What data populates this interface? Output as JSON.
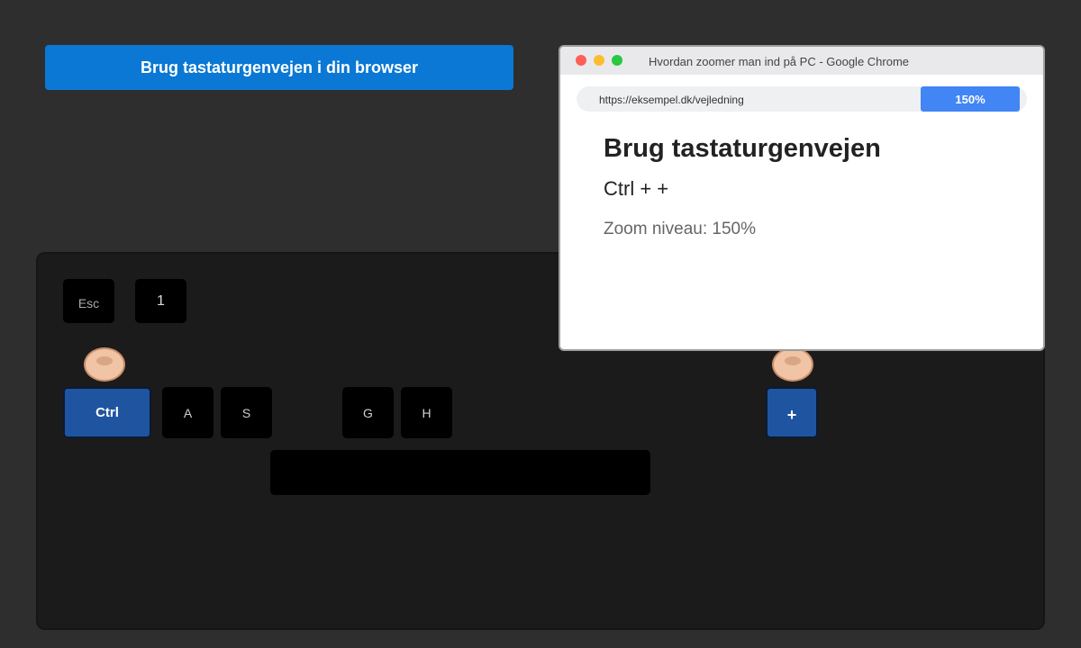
{
  "banner": {
    "title": "Brug tastaturgenvejen i din browser"
  },
  "keyboard": {
    "keys": {
      "esc": "Esc",
      "one": "1",
      "ctrl": "Ctrl",
      "a": "A",
      "s": "S",
      "g": "G",
      "h": "H",
      "plus": "+",
      "space": ""
    },
    "pressed_keys": [
      "Ctrl",
      "+"
    ]
  },
  "browser": {
    "window_title": "Hvordan zoomer man ind på PC - Google Chrome",
    "url": "https://eksempel.dk/vejledning",
    "zoom_badge": "150%",
    "page": {
      "heading": "Brug tastaturgenvejen",
      "shortcut": "Ctrl + +",
      "zoom_level": "Zoom niveau: 150%"
    }
  },
  "colors": {
    "banner": "#0a78d4",
    "pressed_key": "#1f55a0",
    "zoom_badge": "#4285f4",
    "background": "#2e2e2e"
  }
}
